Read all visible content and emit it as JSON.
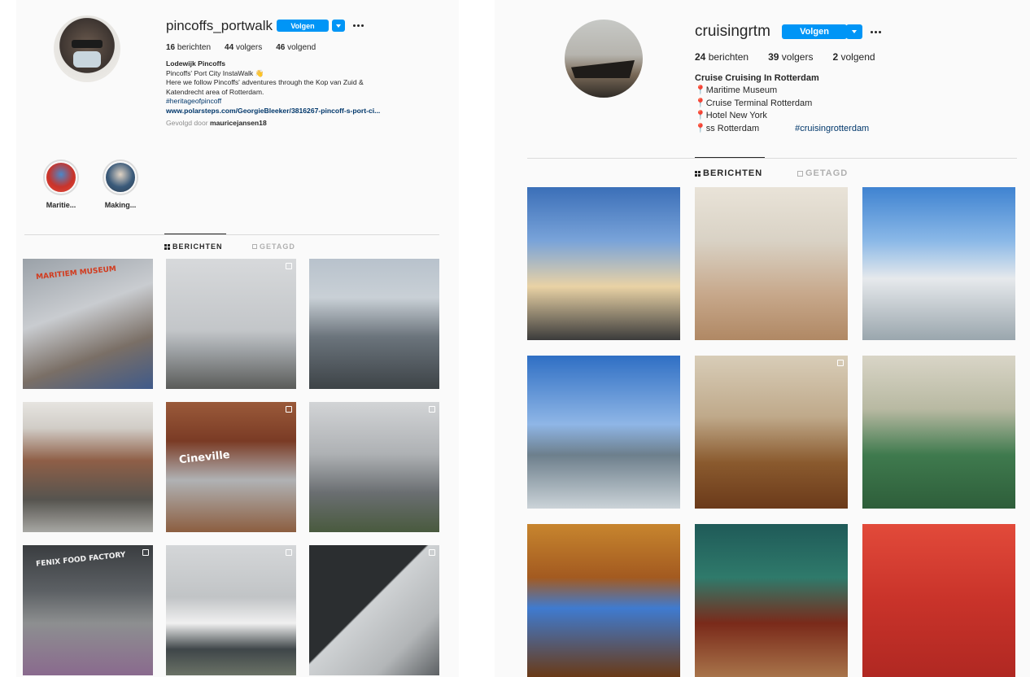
{
  "profiles": [
    {
      "username": "pincoffs_portwalk",
      "follow_label": "Volgen",
      "stats": {
        "posts": "16",
        "posts_label": "berichten",
        "followers": "44",
        "followers_label": "volgers",
        "following": "46",
        "following_label": "volgend"
      },
      "bio": {
        "name": "Lodewijk Pincoffs",
        "lines": [
          "Pincoffs' Port City InstaWalk 👋",
          "Here we follow Pincoffs' adventures through the Kop van Zuid &",
          "Katendrecht area of Rotterdam."
        ],
        "hashtag": "#heritageofpincoff",
        "link": "www.polarsteps.com/GeorgieBleeker/3816267-pincoff-s-port-ci...",
        "followed_by_prefix": "Gevolgd door",
        "followed_by_user": "mauricejansen18"
      },
      "highlights": [
        {
          "label": "Maritie..."
        },
        {
          "label": "Making..."
        }
      ],
      "tabs": [
        {
          "label": "BERICHTEN",
          "active": true
        },
        {
          "label": "GETAGD",
          "active": false
        }
      ]
    },
    {
      "username": "cruisingrtm",
      "follow_label": "Volgen",
      "stats": {
        "posts": "24",
        "posts_label": "berichten",
        "followers": "39",
        "followers_label": "volgers",
        "following": "2",
        "following_label": "volgend"
      },
      "bio": {
        "name": "Cruise Cruising In Rotterdam",
        "lines": [
          "Maritime Museum",
          "Cruise Terminal Rotterdam",
          "Hotel New York",
          "ss Rotterdam"
        ],
        "hashtag": "#cruisingrotterdam"
      },
      "tabs": [
        {
          "label": "BERICHTEN",
          "active": true
        },
        {
          "label": "GETAGD",
          "active": false
        }
      ]
    }
  ],
  "left_posts": [
    {
      "name": "post-maritiem-museum",
      "bg": "linear-gradient(160deg,#9aa1a8 0%,#c9ccd0 40%,#7a6f66 70%,#3f5a8a 100%)",
      "sign_text": "MARITIEM MUSEUM",
      "sign_color": "#d23b1e",
      "multi": false
    },
    {
      "name": "post-erasmus-bridge",
      "bg": "linear-gradient(180deg,#d7d9db 0%,#c3c6c9 55%,#9fa3a6 70%,#5a5b59 100%)",
      "multi": true
    },
    {
      "name": "post-de-rotterdam",
      "bg": "linear-gradient(180deg,#b8c2cc 0%,#c9d0d6 30%,#6b747c 60%,#3d4347 100%)",
      "multi": false
    },
    {
      "name": "post-waterfront",
      "bg": "linear-gradient(180deg,#e6e4e0 0%,#d1cdc7 20%,#8f5f47 45%,#56544f 75%,#a7a7a3 100%)",
      "multi": false
    },
    {
      "name": "post-cineville",
      "bg": "linear-gradient(180deg,#9a5a3a 0%,#7a3b25 30%,#b0b2b4 60%,#8c5e40 100%)",
      "sign_text": "Cineville",
      "sign_color": "#ffffff",
      "multi": true
    },
    {
      "name": "post-towers",
      "bg": "linear-gradient(180deg,#d2d4d6 0%,#aeb1b4 40%,#6a6e71 70%,#495a3e 100%)",
      "multi": true
    },
    {
      "name": "post-fenix-food-factory",
      "bg": "linear-gradient(180deg,#3a3d40 0%,#5c6064 35%,#8d8f90 60%,#8a6a8e 100%)",
      "sign_text": "FENIX FOOD FACTORY",
      "sign_color": "#f2f2f2",
      "multi": true
    },
    {
      "name": "post-ss-rotterdam",
      "bg": "linear-gradient(180deg,#d4d6d8 0%,#c1c4c6 40%,#f0f0f0 60%,#3f4649 80%,#6a7266 100%)",
      "multi": true
    },
    {
      "name": "post-grain-silo",
      "bg": "linear-gradient(135deg,#2b2e30 0%,#2b2e30 45%,#cfd2d4 46%,#b3b6b8 75%,#5d6164 100%)",
      "multi": true
    }
  ],
  "right_posts": [
    {
      "name": "post-dutch-flag",
      "bg": "linear-gradient(180deg,#3b6fb8 0%,#79a3d9 35%,#e9d2a5 65%,#3b3b3b 100%)",
      "multi": false
    },
    {
      "name": "post-deck-promenade",
      "bg": "linear-gradient(180deg,#e9e3d8 0%,#d9d2c5 35%,#c7a88b 70%,#b08864 100%)",
      "multi": false
    },
    {
      "name": "post-lifeboat",
      "bg": "linear-gradient(180deg,#3f83d1 0%,#8ab8e7 35%,#e6e9ec 60%,#9aa6ad 100%)",
      "multi": false
    },
    {
      "name": "post-harbor-view",
      "bg": "linear-gradient(180deg,#2f6fc4 0%,#8fb6e6 45%,#6d7f8c 65%,#cbd3d8 100%)",
      "multi": false
    },
    {
      "name": "post-captain-cabin",
      "bg": "linear-gradient(180deg,#d8cdb8 0%,#bfa98a 40%,#8a5a2e 70%,#6b3a1a 100%)",
      "multi": true
    },
    {
      "name": "post-bridge-controls",
      "bg": "linear-gradient(180deg,#d9d5c7 0%,#b8b9a2 35%,#3f7a4e 65%,#2e5e3a 100%)",
      "multi": false
    },
    {
      "name": "post-lounge",
      "bg": "linear-gradient(180deg,#c7852e 0%,#a35a20 35%,#3f7bd0 55%,#6a3a16 100%)",
      "multi": false
    },
    {
      "name": "post-bar",
      "bg": "linear-gradient(180deg,#1f5a58 0%,#2f7a6b 35%,#7a2a1a 65%,#a8744a 100%)",
      "multi": false
    },
    {
      "name": "post-phone-red-carpet",
      "bg": "linear-gradient(180deg,#e24a3a 0%,#c9332a 50%,#b02822 100%)",
      "multi": false
    }
  ]
}
